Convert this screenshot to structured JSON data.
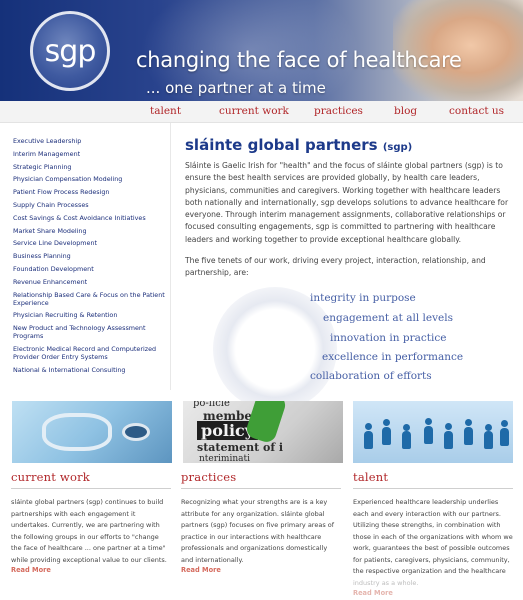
{
  "header": {
    "logo_text": "sgp",
    "tagline": "changing the face of healthcare",
    "subtagline": "... one partner at a time"
  },
  "nav": {
    "items": [
      "talent",
      "current work",
      "practices",
      "blog",
      "contact us"
    ]
  },
  "sidebar": {
    "items": [
      "Executive Leadership",
      "Interim Management",
      "Strategic Planning",
      "Physician Compensation Modeling",
      "Patient Flow Process Redesign",
      "Supply Chain Processes",
      "Cost Savings & Cost Avoidance Initiatives",
      "Market Share Modeling",
      "Service Line Development",
      "Business Planning",
      "Foundation Development",
      "Revenue Enhancement",
      "Relationship Based Care & Focus on the Patient Experience",
      "Physician Recruiting & Retention",
      "New Product and Technology Assessment Programs",
      "Electronic Medical Record and Computerized Provider Order Entry Systems",
      "National & International Consulting"
    ]
  },
  "main": {
    "title": "sláinte global partners",
    "title_sub": "(sgp)",
    "intro": "Sláinte is Gaelic Irish for \"health\" and the focus of sláinte global partners (sgp) is to ensure the best health services are provided globally, by health care leaders, physicians, communities and caregivers. Working together with healthcare leaders both nationally and internationally, sgp develops solutions to advance healthcare for everyone.  Through interim management assignments, collaborative relationships or focused consulting engagements, sgp is committed to partnering with healthcare leaders and working together to provide exceptional healthcare globally.",
    "tenets_intro": "The five tenets of our work, driving every project, interaction, relationship, and partnership, are:",
    "tenets": [
      "integrity in purpose",
      "engagement at all levels",
      "innovation in practice",
      "excellence in performance",
      "collaboration of efforts"
    ]
  },
  "images": {
    "policy_word_top": "po-licie",
    "policy_word_mid": "membe",
    "policy_word": "policy",
    "policy_word_bottom": "statement of i",
    "policy_word_last": "nteriminati"
  },
  "columns": [
    {
      "title": "current work",
      "body": "sláinte global partners (sgp) continues to build partnerships with each engagement it undertakes. Currently, we are partnering with the following groups in our efforts to \"change the face of healthcare ... one partner at a time\" while providing exceptional value to our clients.",
      "more": "Read More"
    },
    {
      "title": "practices",
      "body": "Recognizing what your strengths are is a key attribute for any organization. sláinte global partners (sgp) focuses on five primary areas of practice in our interactions with healthcare professionals and organizations domestically and internationally.",
      "more": "Read More"
    },
    {
      "title": "talent",
      "body": "Experienced healthcare leadership underlies each and every interaction with our partners. Utilizing these strengths, in combination with those in each of the organizations with whom we work, guarantees the best of possible outcomes for patients, caregivers, physicians, community, the respective organization and the healthcare",
      "body_faded": "industry as a whole.",
      "more": "Read More"
    }
  ]
}
